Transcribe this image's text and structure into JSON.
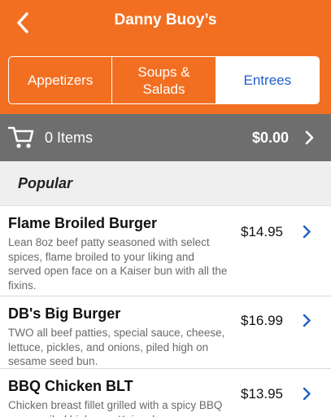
{
  "colors": {
    "accent": "#f26f21",
    "link_blue": "#1f5fc9",
    "cart_bar": "#6e6e6e"
  },
  "header": {
    "title": "Danny Buoy’s",
    "back_icon": "chevron-left-icon"
  },
  "tabs": [
    {
      "label": "Appetizers",
      "active": false
    },
    {
      "label": "Soups &\nSalads",
      "active": false
    },
    {
      "label": "Entrees",
      "active": true
    }
  ],
  "cart": {
    "icon": "cart-icon",
    "count_label": "0 Items",
    "total": "$0.00"
  },
  "section": {
    "label": "Popular"
  },
  "items": [
    {
      "name": "Flame Broiled Burger",
      "description": "Lean 8oz beef patty seasoned with select spices, flame broiled to your liking and served open face on a Kaiser bun with all the fixins.",
      "price": "$14.95"
    },
    {
      "name": "DB's Big Burger",
      "description": "TWO all beef patties, special sauce, cheese, lettuce, pickles, and onions, piled high on sesame seed bun.",
      "price": "$16.99"
    },
    {
      "name": "BBQ Chicken BLT",
      "description": "Chicken breast fillet grilled with a spicy BBQ sauce, piled high on a Kaiser bun",
      "price": "$13.95"
    }
  ]
}
